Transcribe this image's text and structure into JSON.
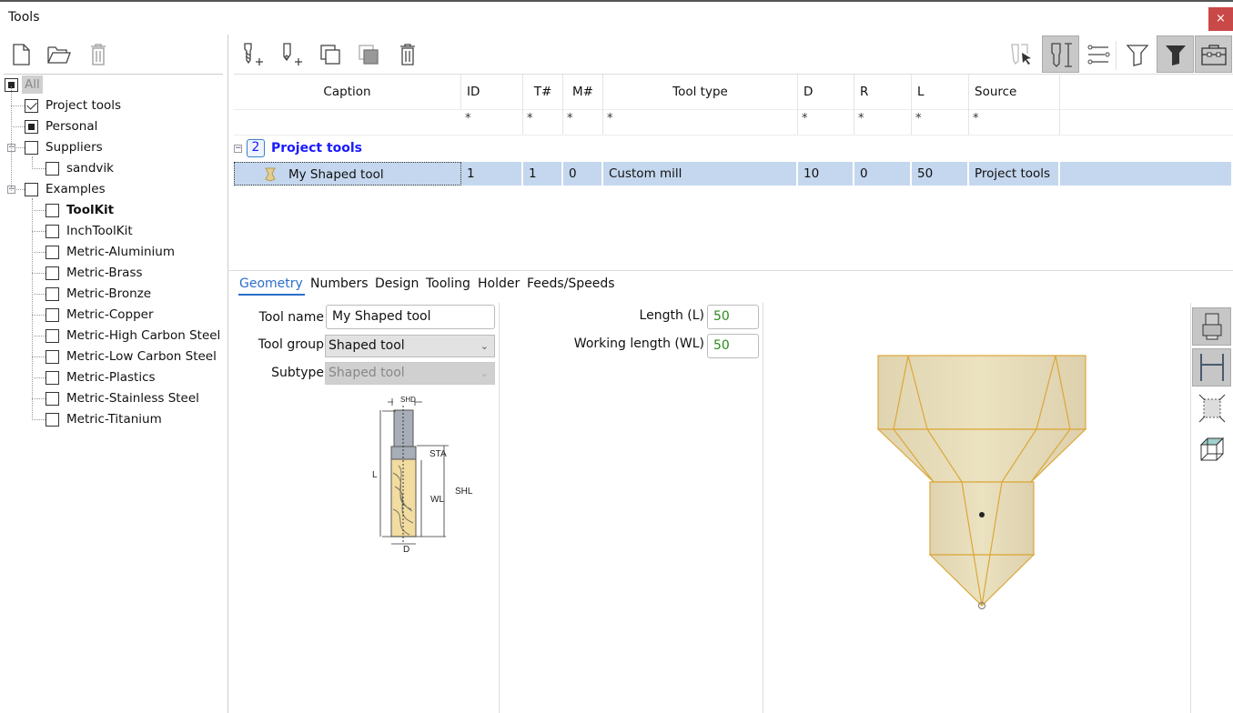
{
  "window": {
    "title": "Tools",
    "close_label": "×"
  },
  "left_toolbar": {
    "icons": [
      "new-file-icon",
      "open-folder-icon",
      "delete-icon"
    ]
  },
  "tree": {
    "items": [
      {
        "label": "All",
        "state": "partial",
        "level": 0
      },
      {
        "label": "Project tools",
        "state": "checked",
        "level": 1
      },
      {
        "label": "Personal",
        "state": "partial",
        "level": 1
      },
      {
        "label": "Suppliers",
        "state": "unchecked",
        "level": 1
      },
      {
        "label": "sandvik",
        "state": "unchecked",
        "level": 2
      },
      {
        "label": "Examples",
        "state": "unchecked",
        "level": 1
      },
      {
        "label": "ToolKit",
        "state": "unchecked",
        "level": 2,
        "bold": true
      },
      {
        "label": "InchToolKit",
        "state": "unchecked",
        "level": 2
      },
      {
        "label": "Metric-Aluminium",
        "state": "unchecked",
        "level": 2
      },
      {
        "label": "Metric-Brass",
        "state": "unchecked",
        "level": 2
      },
      {
        "label": "Metric-Bronze",
        "state": "unchecked",
        "level": 2
      },
      {
        "label": "Metric-Copper",
        "state": "unchecked",
        "level": 2
      },
      {
        "label": "Metric-High Carbon Steel",
        "state": "unchecked",
        "level": 2
      },
      {
        "label": "Metric-Low Carbon Steel",
        "state": "unchecked",
        "level": 2
      },
      {
        "label": "Metric-Plastics",
        "state": "unchecked",
        "level": 2
      },
      {
        "label": "Metric-Stainless Steel",
        "state": "unchecked",
        "level": 2
      },
      {
        "label": "Metric-Titanium",
        "state": "unchecked",
        "level": 2
      }
    ]
  },
  "table": {
    "columns": [
      "Caption",
      "ID",
      "T#",
      "M#",
      "Tool type",
      "D",
      "R",
      "L",
      "Source"
    ],
    "filter": "*",
    "group": {
      "label": "Project tools",
      "badge": "2"
    },
    "rows": [
      {
        "caption": "My Shaped tool",
        "id": "1",
        "t": "1",
        "m": "0",
        "type": "Custom mill",
        "d": "10",
        "r": "0",
        "l": "50",
        "source": "Project tools"
      }
    ]
  },
  "tabs": [
    "Geometry",
    "Numbers",
    "Design",
    "Tooling",
    "Holder",
    "Feeds/Speeds"
  ],
  "active_tab": "Geometry",
  "form": {
    "tool_name_label": "Tool name",
    "tool_name": "My Shaped tool",
    "tool_group_label": "Tool group",
    "tool_group": "Shaped tool",
    "subtype_label": "Subtype",
    "subtype": "Shaped tool",
    "length_label": "Length (L)",
    "length": "50",
    "wl_label": "Working length (WL)",
    "wl": "50"
  },
  "diagram": {
    "labels": {
      "shd": "SHD",
      "sta": "STA",
      "l": "L",
      "wl": "WL",
      "shl": "SHL",
      "d": "D"
    }
  },
  "colors": {
    "accent": "#2a6fc9",
    "group_text": "#1a1aff",
    "selection": "#c4d7ee",
    "value_green": "#2a8a1a",
    "tool_body": "#e8dbb6",
    "tool_edge": "#dba73a"
  }
}
